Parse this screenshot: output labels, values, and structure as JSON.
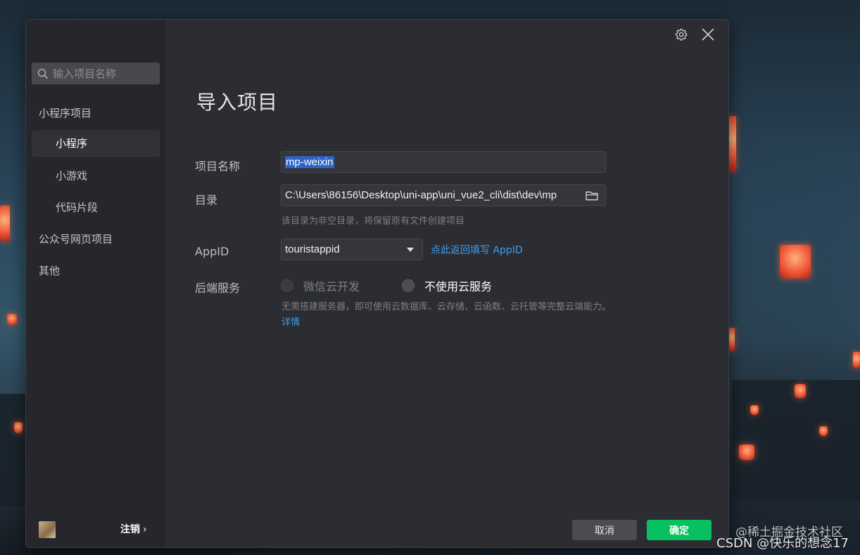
{
  "sidebar": {
    "search_placeholder": "输入项目名称",
    "items": [
      {
        "label": "小程序项目"
      },
      {
        "label": "小程序"
      },
      {
        "label": "小游戏"
      },
      {
        "label": "代码片段"
      },
      {
        "label": "公众号网页项目"
      },
      {
        "label": "其他"
      }
    ],
    "logout_label": "注销",
    "logout_chevron": "›"
  },
  "header": {
    "title": "导入项目"
  },
  "form": {
    "name_label": "项目名称",
    "name_value": "mp-weixin",
    "dir_label": "目录",
    "dir_value": "C:\\Users\\86156\\Desktop\\uni-app\\uni_vue2_cli\\dist\\dev\\mp",
    "dir_hint": "该目录为非空目录，将保留原有文件创建项目",
    "appid_label": "AppID",
    "appid_value": "touristappid",
    "appid_link": "点此返回填写 AppID",
    "backend_label": "后端服务",
    "backend_options": [
      {
        "label": "微信云开发",
        "disabled": true
      },
      {
        "label": "不使用云服务",
        "disabled": false
      }
    ],
    "backend_desc": "无需搭建服务器，即可使用云数据库、云存储、云函数、云托管等完整云端能力。",
    "backend_detail_link": "详情"
  },
  "footer": {
    "cancel_label": "取消",
    "ok_label": "确定"
  },
  "watermark": {
    "line1": "@稀土掘金技术社区",
    "line2": "CSDN @快乐的想念17"
  },
  "colors": {
    "accent_green": "#07c160",
    "link_blue": "#3a9ff0",
    "selection": "#2f62c8"
  }
}
